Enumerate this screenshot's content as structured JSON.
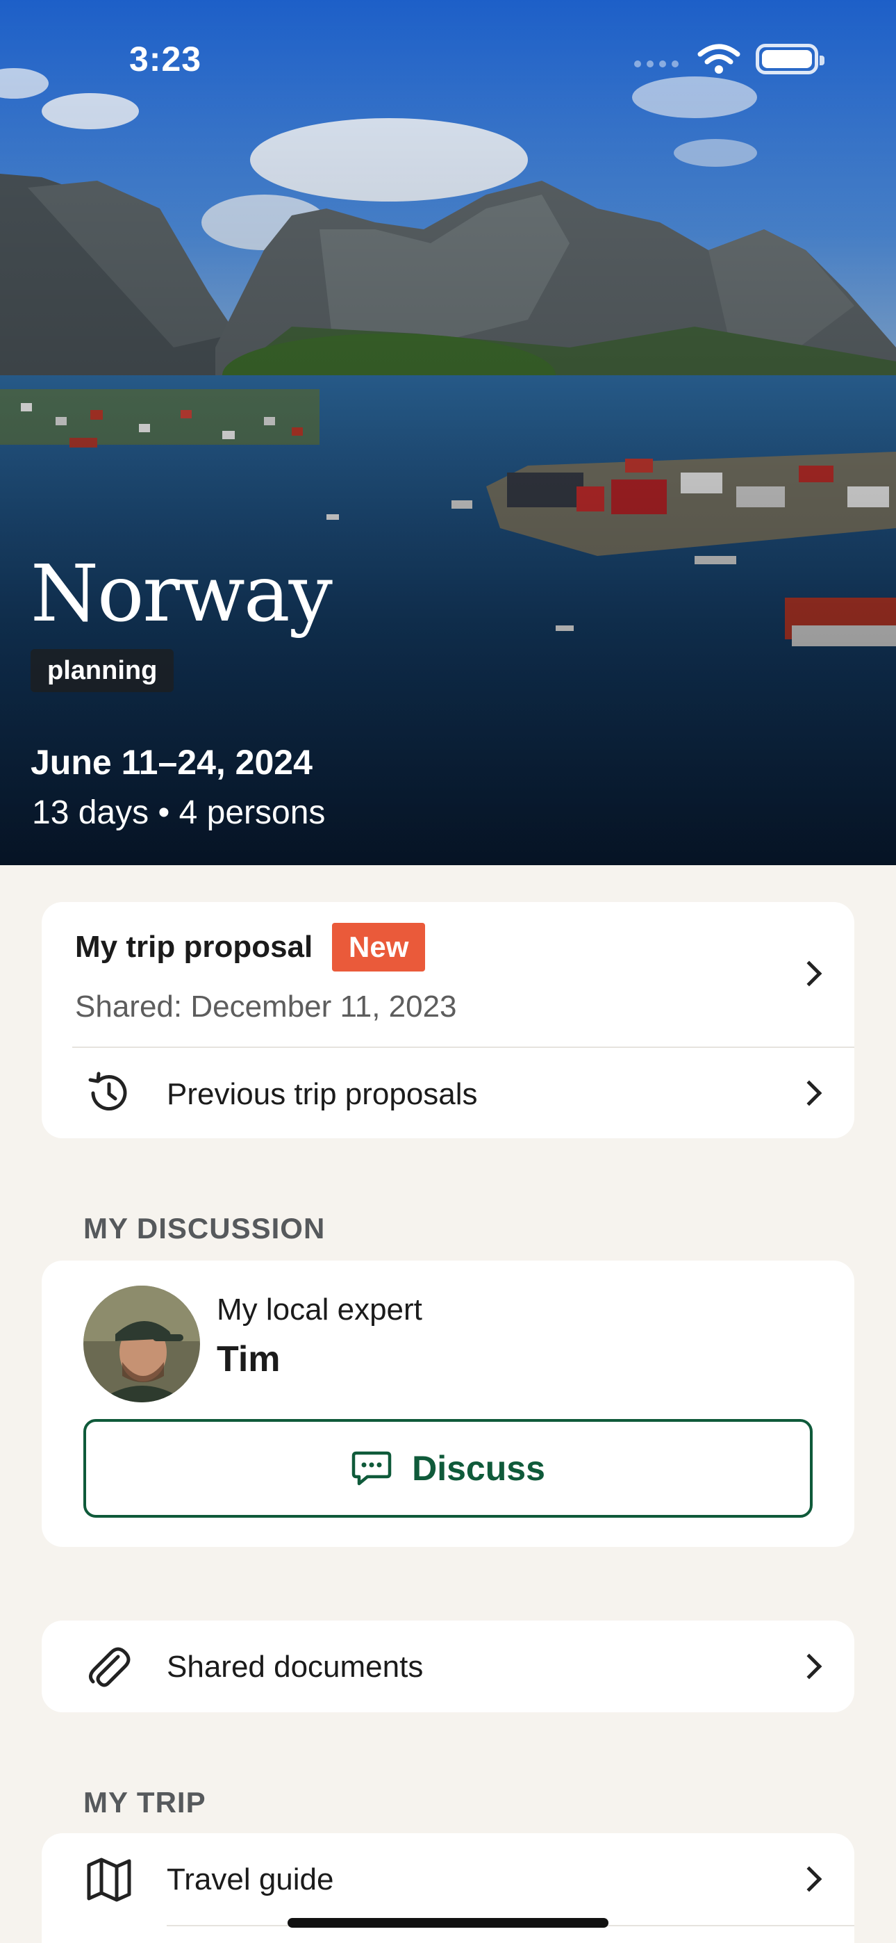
{
  "status_bar": {
    "time": "3:23"
  },
  "hero": {
    "title": "Norway",
    "status": "planning",
    "dates": "June 11–24, 2024",
    "meta": "13 days • 4 persons"
  },
  "proposal": {
    "title": "My trip proposal",
    "badge": "New",
    "shared": "Shared: December 11, 2023",
    "previous_label": "Previous trip proposals"
  },
  "discussion": {
    "section_label": "MY DISCUSSION",
    "role": "My local expert",
    "name": "Tim",
    "button_label": "Discuss"
  },
  "documents": {
    "label": "Shared documents"
  },
  "trip": {
    "section_label": "MY TRIP",
    "items": [
      {
        "label": "Travel guide"
      }
    ]
  },
  "colors": {
    "accent_green": "#0f5a3a",
    "badge_orange": "#ea5a3a",
    "background": "#f6f3ee"
  }
}
